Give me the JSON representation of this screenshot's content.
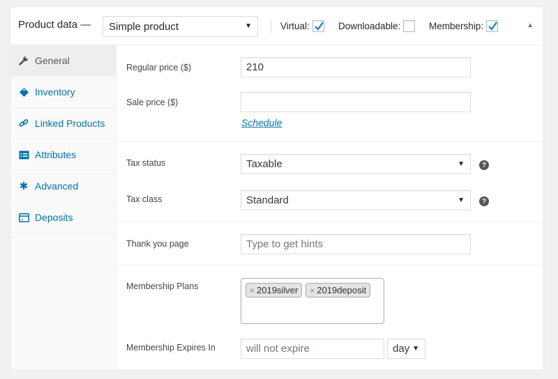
{
  "header": {
    "title": "Product data —",
    "product_type": "Simple product",
    "options": [
      {
        "label": "Virtual:",
        "checked": true
      },
      {
        "label": "Downloadable:",
        "checked": false
      },
      {
        "label": "Membership:",
        "checked": true
      }
    ]
  },
  "tabs": [
    {
      "label": "General",
      "icon": "wrench-icon",
      "active": true
    },
    {
      "label": "Inventory",
      "icon": "tag-icon",
      "active": false
    },
    {
      "label": "Linked Products",
      "icon": "link-icon",
      "active": false
    },
    {
      "label": "Attributes",
      "icon": "list-card-icon",
      "active": false
    },
    {
      "label": "Advanced",
      "icon": "gear-icon",
      "active": false
    },
    {
      "label": "Deposits",
      "icon": "credit-card-icon",
      "active": false
    }
  ],
  "general": {
    "regular_price": {
      "label": "Regular price ($)",
      "value": "210"
    },
    "sale_price": {
      "label": "Sale price ($)",
      "value": "",
      "schedule_link": "Schedule"
    },
    "tax_status": {
      "label": "Tax status",
      "value": "Taxable"
    },
    "tax_class": {
      "label": "Tax class",
      "value": "Standard"
    },
    "thank_you_page": {
      "label": "Thank you page",
      "placeholder": "Type to get hints"
    },
    "membership_plans": {
      "label": "Membership Plans",
      "plans": [
        "2019silver",
        "2019deposit"
      ]
    },
    "membership_expires": {
      "label": "Membership Expires In",
      "placeholder": "will not expire",
      "unit": "day"
    }
  },
  "colors": {
    "accent": "#0073aa",
    "checkmark": "#1e8cbe"
  }
}
